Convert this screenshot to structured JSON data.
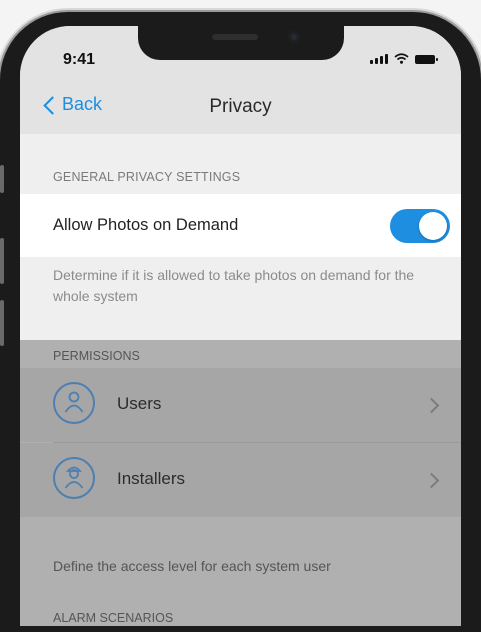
{
  "status_bar": {
    "time": "9:41"
  },
  "nav": {
    "back_label": "Back",
    "title": "Privacy"
  },
  "general": {
    "header": "GENERAL PRIVACY SETTINGS",
    "toggle_label": "Allow Photos on Demand",
    "toggle_on": true,
    "description": "Determine if it is allowed to take photos on demand for the whole system"
  },
  "permissions": {
    "header": "PERMISSIONS",
    "items": [
      {
        "label": "Users",
        "icon": "user-icon"
      },
      {
        "label": "Installers",
        "icon": "installer-icon"
      }
    ],
    "footer": "Define the access level for each system user"
  },
  "next_section": {
    "header": "ALARM SCENARIOS"
  },
  "colors": {
    "accent": "#1d8ee0",
    "dim_overlay": "#b0b0b0"
  }
}
